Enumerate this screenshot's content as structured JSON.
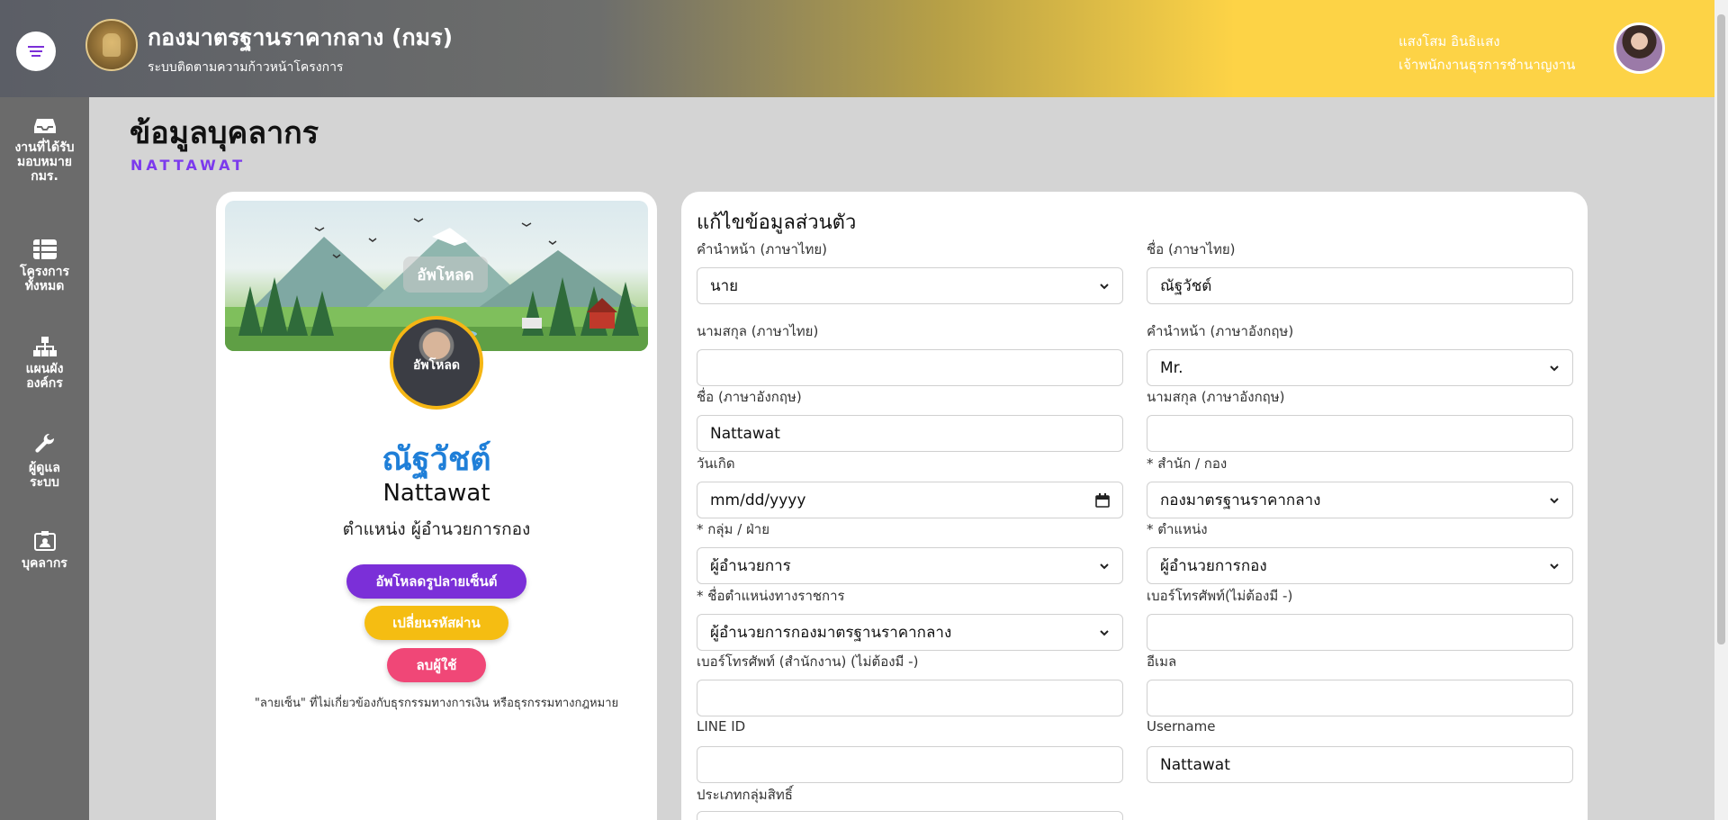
{
  "header": {
    "org_title": "กองมาตรฐานราคากลาง (กมร)",
    "org_subtitle": "ระบบติดตามความก้าวหน้าโครงการ",
    "user_name": "แสงโสม อินธิแสง",
    "user_role": "เจ้าพนักงานธุรการชำนาญงาน"
  },
  "sidebar": {
    "items": [
      {
        "label": "งานที่ได้รับมอบหมาย กมร.",
        "icon": "inbox-icon"
      },
      {
        "label": "โครงการทั้งหมด",
        "icon": "table-icon"
      },
      {
        "label": "แผนผังองค์กร",
        "icon": "sitemap-icon"
      },
      {
        "label": "ผู้ดูแลระบบ",
        "icon": "wrench-icon"
      },
      {
        "label": "บุคลากร",
        "icon": "id-card-icon"
      }
    ]
  },
  "page": {
    "title": "ข้อมูลบุคลากร",
    "subtitle": "NATTAWAT"
  },
  "profile": {
    "cover_upload": "อัพโหลด",
    "photo_upload": "อัพโหลด",
    "name_thai": "ณัฐวัชต์",
    "name_eng": "Nattawat",
    "position": "ตำแหน่ง ผู้อำนวยการกอง",
    "btn_upload_signature": "อัพโหลดรูปลายเซ็นต์",
    "btn_change_password": "เปลี่ยนรหัสผ่าน",
    "btn_delete_user": "ลบผู้ใช้",
    "note": "\"ลายเซ็น\" ที่ไม่เกี่ยวข้องกับธุรกรรมทางการเงิน หรือธุรกรรมทางกฎหมาย"
  },
  "form": {
    "title": "แก้ไขข้อมูลส่วนตัว",
    "fields": {
      "prefix_th": {
        "label": "คำนำหน้า (ภาษาไทย)",
        "value": "นาย"
      },
      "firstname_th": {
        "label": "ชื่อ (ภาษาไทย)",
        "value": "ณัฐวัชต์"
      },
      "lastname_th": {
        "label": "นามสกุล (ภาษาไทย)",
        "value": ""
      },
      "prefix_en": {
        "label": "คำนำหน้า (ภาษาอังกฤษ)",
        "value": "Mr."
      },
      "firstname_en": {
        "label": "ชื่อ (ภาษาอังกฤษ)",
        "value": "Nattawat"
      },
      "lastname_en": {
        "label": "นามสกุล (ภาษาอังกฤษ)",
        "value": ""
      },
      "birthdate": {
        "label": "วันเกิด",
        "value": "mm/dd/yyyy"
      },
      "office": {
        "label": "* สำนัก / กอง",
        "value": "กองมาตรฐานราคากลาง"
      },
      "group": {
        "label": "* กลุ่ม / ฝ่าย",
        "value": "ผู้อำนวยการ"
      },
      "position": {
        "label": "* ตำแหน่ง",
        "value": "ผู้อำนวยการกอง"
      },
      "official_position": {
        "label": "* ชื่อตำแหน่งทางราชการ",
        "value": "ผู้อำนวยการกองมาตรฐานราคากลาง"
      },
      "phone": {
        "label": "เบอร์โทรศัพท์(ไม่ต้องมี -)",
        "value": ""
      },
      "office_phone": {
        "label": "เบอร์โทรศัพท์ (สำนักงาน) (ไม่ต้องมี -)",
        "value": ""
      },
      "email": {
        "label": "อีเมล",
        "value": ""
      },
      "line_id": {
        "label": "LINE ID",
        "value": ""
      },
      "username": {
        "label": "Username",
        "value": "Nattawat"
      },
      "role_group": {
        "label": "ประเภทกลุ่มสิทธิ์",
        "value": ""
      }
    }
  },
  "colors": {
    "accent_purple": "#7b2fd8",
    "accent_yellow": "#f5bd12",
    "accent_pink": "#f04777",
    "name_blue": "#1f7fd8",
    "header_yellow": "#fdd346",
    "sidebar_gray": "#6b6b6b"
  }
}
